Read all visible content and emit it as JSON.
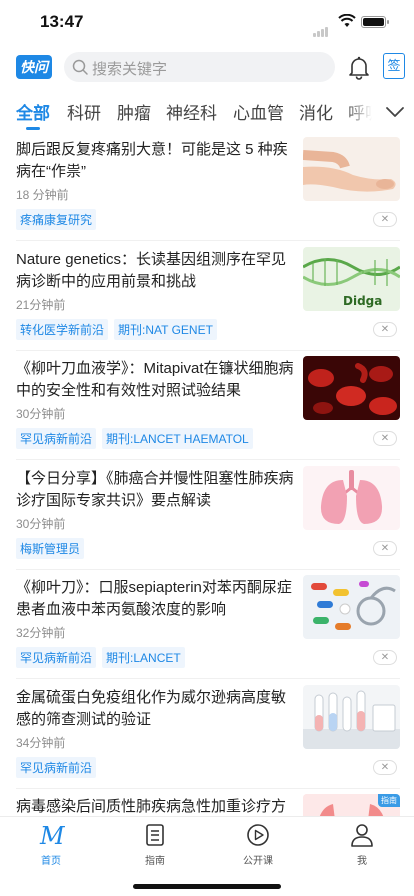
{
  "status_bar": {
    "time": "13:47"
  },
  "header": {
    "logo": "快问",
    "search_placeholder": "搜索关键字",
    "signin_label": "签"
  },
  "tabs": [
    "全部",
    "科研",
    "肿瘤",
    "神经科",
    "心血管",
    "消化",
    "呼吸"
  ],
  "articles": [
    {
      "title": "脚后跟反复疼痛别大意！可能是这 5 种疾病在“作祟”",
      "time": "18 分钟前",
      "tags": [
        "疼痛康复研究"
      ],
      "thumb": "foot"
    },
    {
      "title": "Nature genetics：长读基因组测序在罕见病诊断中的应用前景和挑战",
      "time": "21分钟前",
      "tags": [
        "转化医学新前沿",
        "期刊:NAT GENET"
      ],
      "thumb": "dna",
      "thumb_text": "Didga"
    },
    {
      "title": "《柳叶刀血液学》：Mitapivat在镰状细胞病中的安全性和有效性对照试验结果",
      "time": "30分钟前",
      "tags": [
        "罕见病新前沿",
        "期刊:LANCET HAEMATOL"
      ],
      "thumb": "blood-cells"
    },
    {
      "title": "【今日分享】《肺癌合并慢性阻塞性肺疾病诊疗国际专家共识》要点解读",
      "time": "30分钟前",
      "tags": [
        "梅斯管理员"
      ],
      "thumb": "lungs"
    },
    {
      "title": "《柳叶刀》：口服sepiapterin对苯丙酮尿症患者血液中苯丙氨酸浓度的影响",
      "time": "32分钟前",
      "tags": [
        "罕见病新前沿",
        "期刊:LANCET"
      ],
      "thumb": "pills"
    },
    {
      "title": "金属硫蛋白免疫组化作为威尔逊病高度敏感的筛查测试的验证",
      "time": "34分钟前",
      "tags": [
        "罕见病新前沿"
      ],
      "thumb": "lab-tubes"
    },
    {
      "title": "病毒感染后间质性肺疾病急性加重诊疗方",
      "time": "",
      "tags": [],
      "thumb": "lung-scan",
      "thumb_badge": "指南"
    }
  ],
  "close_label": "✕",
  "tabbar": [
    {
      "label": "首页",
      "icon": "home-m-icon",
      "active": true
    },
    {
      "label": "指南",
      "icon": "guide-doc-icon",
      "active": false
    },
    {
      "label": "公开课",
      "icon": "play-circle-icon",
      "active": false
    },
    {
      "label": "我",
      "icon": "person-icon",
      "active": false
    }
  ],
  "colors": {
    "accent": "#1e88e5",
    "tag_bg": "#eef5fd",
    "muted": "#8d8d8d"
  }
}
